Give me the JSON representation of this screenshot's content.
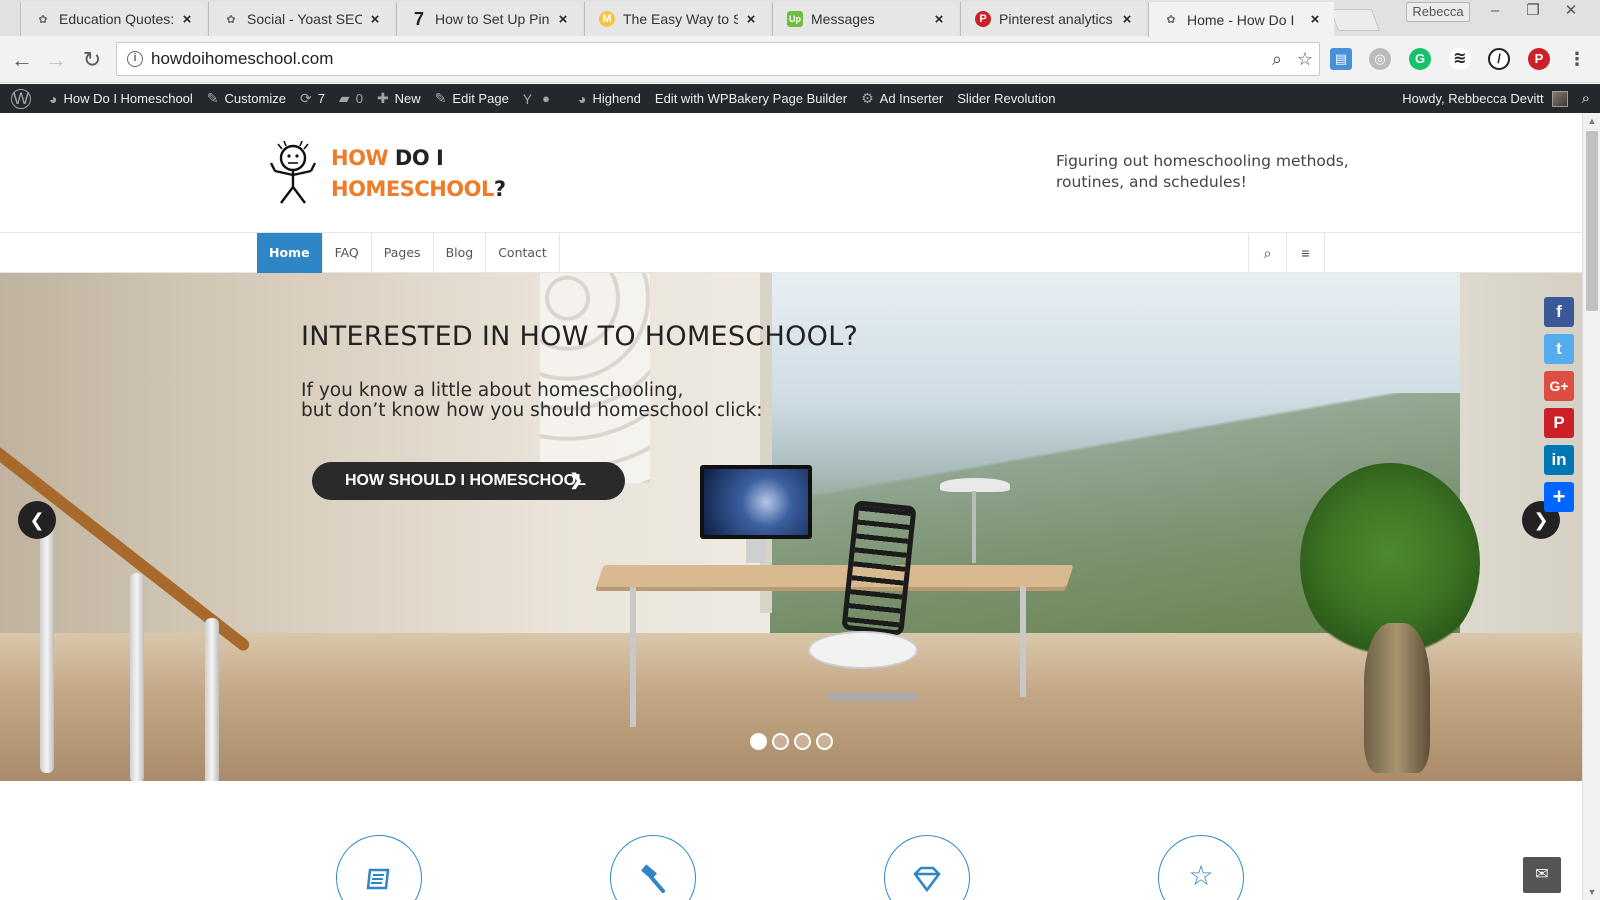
{
  "browser": {
    "tabs": [
      {
        "title": "Education Quotes:",
        "color": "#8a8a8a",
        "glyph": "✿"
      },
      {
        "title": "Social - Yoast SEO",
        "color": "#8a8a8a",
        "glyph": "✿"
      },
      {
        "title": "How to Set Up Pin",
        "color": "#222222",
        "glyph": "7"
      },
      {
        "title": "The Easy Way to S",
        "color": "#f4c542",
        "glyph": "M"
      },
      {
        "title": "Messages",
        "color": "#6fbf3f",
        "glyph": "Up"
      },
      {
        "title": "Pinterest analytics",
        "color": "#cb2027",
        "glyph": "P"
      },
      {
        "title": "Home - How Do I",
        "color": "#8a8a8a",
        "glyph": "✿"
      }
    ],
    "profile": "Rebecca",
    "url": "howdoihomeschool.com"
  },
  "adminbar": {
    "site_name": "How Do I Homeschool",
    "customize": "Customize",
    "updates": "7",
    "comments": "0",
    "new": "New",
    "edit_page": "Edit Page",
    "highend": "Highend",
    "wpbakery": "Edit with WPBakery Page Builder",
    "ad_inserter": "Ad Inserter",
    "slider_revolution": "Slider Revolution",
    "howdy": "Howdy, Rebbecca Devitt"
  },
  "site": {
    "logo_line1_a": "HOW",
    "logo_line1_b": " DO I",
    "logo_line2_a": "HOMESCHOOL",
    "logo_line2_b": "?",
    "tagline": "Figuring out homeschooling methods, routines, and schedules!",
    "menu": [
      "Home",
      "FAQ",
      "Pages",
      "Blog",
      "Contact"
    ]
  },
  "slider": {
    "title": "INTERESTED IN HOW TO HOMESCHOOL?",
    "text_line1": "If you know a little about homeschooling,",
    "text_line2": "but don’t know how you should homeschool click:",
    "cta": "HOW SHOULD I HOMESCHOOL",
    "slide_count": 4
  },
  "features": {
    "icons": [
      "book-icon",
      "hammer-icon",
      "diamond-icon",
      "star-icon"
    ]
  },
  "share": [
    {
      "name": "facebook",
      "label": "f",
      "color": "#3b5998"
    },
    {
      "name": "twitter",
      "label": "t",
      "color": "#55acee"
    },
    {
      "name": "google-plus",
      "label": "G+",
      "color": "#dc4e41"
    },
    {
      "name": "pinterest",
      "label": "P",
      "color": "#cb2027"
    },
    {
      "name": "linkedin",
      "label": "in",
      "color": "#0077b5"
    },
    {
      "name": "share",
      "label": "+",
      "color": "#0166ff"
    }
  ]
}
